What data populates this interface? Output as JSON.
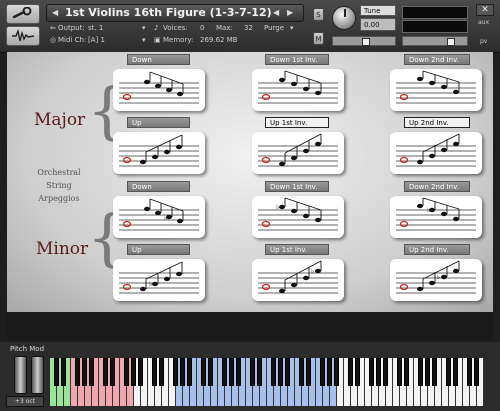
{
  "header": {
    "instrument_title": "1st Violins 16th Figure (1-3-7-12)",
    "output_label": "Output:",
    "output_value": "st. 1",
    "midi_label": "Midi Ch:",
    "midi_value": "[A] 1",
    "voices_label": "Voices:",
    "voices_value": "0",
    "max_label": "Max:",
    "max_value": "32",
    "purge_label": "Purge",
    "memory_label": "Memory:",
    "memory_value": "269.62 MB",
    "solo_label": "S",
    "mute_label": "M",
    "tune_label": "Tune",
    "tune_value": "0.00",
    "aux_label": "aux",
    "pv_label": "pv"
  },
  "panel": {
    "major_label": "Major",
    "minor_label": "Minor",
    "side_caption": [
      "Orchestral",
      "String",
      "Arpeggios"
    ],
    "buttons": [
      {
        "label": "Down",
        "selected": false
      },
      {
        "label": "Down 1st Inv.",
        "selected": false
      },
      {
        "label": "Down 2nd Inv.",
        "selected": false
      },
      {
        "label": "Up",
        "selected": false
      },
      {
        "label": "Up 1st Inv.",
        "selected": true
      },
      {
        "label": "Up 2nd Inv.",
        "selected": true
      },
      {
        "label": "Down",
        "selected": false
      },
      {
        "label": "Down 1st Inv.",
        "selected": false
      },
      {
        "label": "Down 2nd Inv.",
        "selected": false
      },
      {
        "label": "Up",
        "selected": false
      },
      {
        "label": "Up 1st Inv.",
        "selected": false
      },
      {
        "label": "Up 2nd Inv.",
        "selected": false
      }
    ]
  },
  "keyboard": {
    "pitch_mod_label": "Pitch Mod",
    "octave_label": "+3 oct"
  },
  "colors": {
    "accent": "#5a1a1a",
    "clef_red": "#d02020",
    "keyswitch_green": "#9be39b",
    "keyswitch_pink": "#f0a8b0",
    "playable_blue": "#a8c0ec"
  },
  "icons": [
    "wrench-icon",
    "waveform-icon",
    "solo-icon",
    "mute-icon",
    "tune-knob-icon",
    "treble-clef-icon"
  ]
}
